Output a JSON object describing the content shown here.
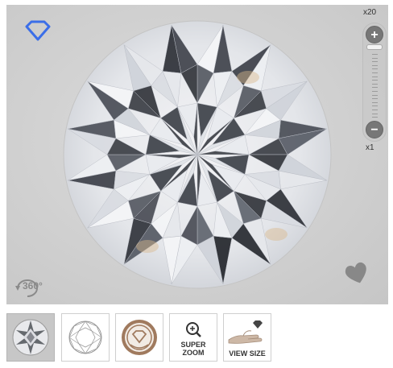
{
  "viewer": {
    "rotate_label": "360°",
    "zoom_max_label": "x20",
    "zoom_min_label": "x1",
    "zoom_plus": "+",
    "zoom_minus": "−",
    "zoom_level_fraction": 0.0
  },
  "thumbnails": [
    {
      "name": "photo",
      "label": ""
    },
    {
      "name": "diagram",
      "label": ""
    },
    {
      "name": "certificate",
      "label": ""
    },
    {
      "name": "super-zoom",
      "label_line1": "SUPER",
      "label_line2": "ZOOM"
    },
    {
      "name": "view-size",
      "label": "VIEW SIZE"
    }
  ],
  "colors": {
    "brand_blue": "#3b6ee8",
    "heart_gray": "#888888",
    "cert_bronze": "#a07a5e"
  },
  "icons": [
    "diamond-logo-icon",
    "rotate-360-icon",
    "heart-icon",
    "zoom-plus-icon",
    "zoom-minus-icon",
    "magnifier-icon",
    "hand-icon"
  ]
}
